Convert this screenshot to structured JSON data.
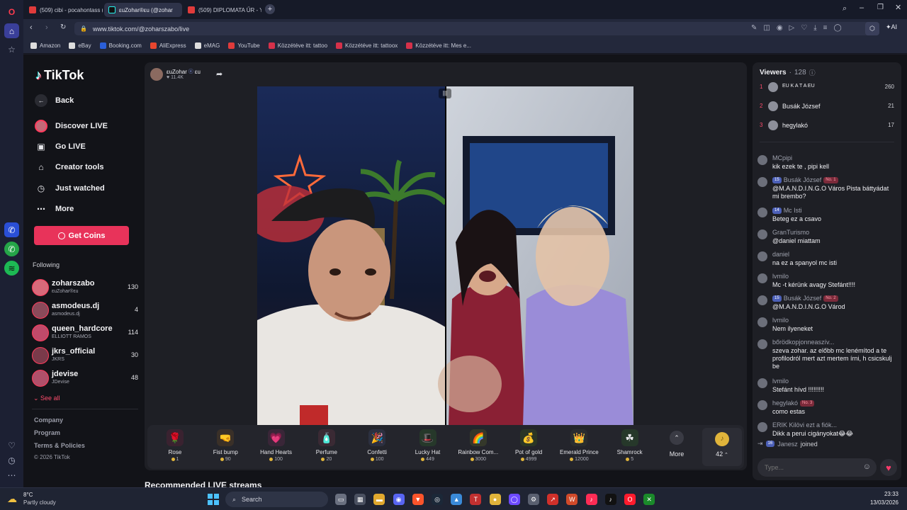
{
  "browser": {
    "tabs": [
      {
        "label": "(509) cibi - pocahontass (",
        "color": "#e03b3b"
      },
      {
        "label": "εuZohar®εu (@zohar",
        "color": "#25f4ee"
      },
      {
        "label": "(509) DIPLOMATA ŰR - Yo",
        "color": "#e03b3b"
      }
    ],
    "new_tab": "+",
    "url": "www.tiktok.com/@zoharszabo/live",
    "ai_label": "AI",
    "bookmarks": [
      {
        "label": "Amazon",
        "color": "#dddddd"
      },
      {
        "label": "eBay",
        "color": "#dddddd"
      },
      {
        "label": "Booking.com",
        "color": "#2b5fd9"
      },
      {
        "label": "AliExpress",
        "color": "#e8462f"
      },
      {
        "label": "eMAG",
        "color": "#dddddd"
      },
      {
        "label": "YouTube",
        "color": "#e03b3b"
      },
      {
        "label": "Közzétéve itt: tattoo",
        "color": "#d6314a"
      },
      {
        "label": "Közzétéve itt: tattoox",
        "color": "#d6314a"
      },
      {
        "label": "Közzétéve itt: Mes e...",
        "color": "#d6314a"
      }
    ]
  },
  "sidebar": {
    "logo": "TikTok",
    "nav": [
      {
        "label": "Back",
        "icon": "arrow-left-icon"
      },
      {
        "label": "Discover LIVE",
        "icon": "avatar-icon"
      },
      {
        "label": "Go LIVE",
        "icon": "camera-icon"
      },
      {
        "label": "Creator tools",
        "icon": "home-icon"
      },
      {
        "label": "Just watched",
        "icon": "history-icon"
      },
      {
        "label": "More",
        "icon": "more-icon"
      }
    ],
    "get_coins": "Get Coins",
    "following_title": "Following",
    "following": [
      {
        "name": "zoharszabo",
        "sub": "εuZohar®εu",
        "count": "130",
        "color": "#d86a7a"
      },
      {
        "name": "asmodeus.dj",
        "sub": "asmodeus.dj",
        "count": "4",
        "color": "#8a4a5a"
      },
      {
        "name": "queen_hardcore",
        "sub": "ELLIOTT RAMOS",
        "count": "114",
        "color": "#c04a6a"
      },
      {
        "name": "jkrs_official",
        "sub": "JKRS",
        "count": "30",
        "color": "#7a3a4a"
      },
      {
        "name": "jdevise",
        "sub": "JDevise",
        "count": "48",
        "color": "#b0506a"
      }
    ],
    "see_all": "See all",
    "footer": [
      "Company",
      "Program",
      "Terms & Policies"
    ],
    "copyright": "© 2026 TikTok"
  },
  "stream": {
    "host_name": "εuZohar",
    "host_suffix": "εu",
    "likes": "11.4K",
    "recommended_title": "Recommended LIVE streams",
    "gifts": [
      {
        "name": "Rose",
        "price": "1",
        "emoji": "🌹",
        "bg": "#3a2230"
      },
      {
        "name": "Fist bump",
        "price": "90",
        "emoji": "🤜",
        "bg": "#3a3028"
      },
      {
        "name": "Hand Hearts",
        "price": "100",
        "emoji": "💗",
        "bg": "#3a2638"
      },
      {
        "name": "Perfume",
        "price": "20",
        "emoji": "🧴",
        "bg": "#3a2a34"
      },
      {
        "name": "Confetti",
        "price": "100",
        "emoji": "🎉",
        "bg": "#2c3040"
      },
      {
        "name": "Lucky Hat",
        "price": "449",
        "emoji": "🎩",
        "bg": "#26382a"
      },
      {
        "name": "Rainbow Com...",
        "price": "3000",
        "emoji": "🌈",
        "bg": "#34382a"
      },
      {
        "name": "Pot of gold",
        "price": "4999",
        "emoji": "💰",
        "bg": "#2a3626"
      },
      {
        "name": "Emerald Prince",
        "price": "12000",
        "emoji": "👑",
        "bg": "#2a2e30"
      },
      {
        "name": "Shamrock",
        "price": "5",
        "emoji": "☘",
        "bg": "#26382a"
      }
    ],
    "more_label": "More",
    "coins_count": "42"
  },
  "chat": {
    "viewers_label": "Viewers",
    "viewers_count": "128",
    "top_viewers": [
      {
        "rank": "1",
        "name": "ΕU Κ Α Τ Α ΕU",
        "score": "260"
      },
      {
        "rank": "2",
        "name": "Busák József",
        "score": "21"
      },
      {
        "rank": "3",
        "name": "hegylakó",
        "score": "17"
      }
    ],
    "messages": [
      {
        "user": "MCpipi",
        "text": "kik ezek te , pipi kell",
        "level": "",
        "rank": ""
      },
      {
        "user": "Busák József",
        "text": "@M.A.N.D.I.N.G.O Város Pista báttyádat mi brembo?",
        "level": "15",
        "rank": "No. 1"
      },
      {
        "user": "Mc Isti",
        "text": "Beteg ez a csavo",
        "level": "14",
        "rank": ""
      },
      {
        "user": "GranTurismo",
        "text": "@daniel miattam",
        "level": "",
        "rank": ""
      },
      {
        "user": "daniel",
        "text": "na ez a spanyol mc isti",
        "level": "",
        "rank": ""
      },
      {
        "user": "lvmilo",
        "text": "Mc -t kérünk avagy Stefánt!!!!",
        "level": "",
        "rank": ""
      },
      {
        "user": "Busák József",
        "text": "@M.A.N.D.I.N.G.O Várod",
        "level": "15",
        "rank": "No. 2"
      },
      {
        "user": "lvmilo",
        "text": "Nem ilyeneket",
        "level": "",
        "rank": ""
      },
      {
        "user": "bőrödkopjonneaszív...",
        "text": "szeva zohar. az előbb mc lenémítod a te profilodról mert azt mertem írni, h csicskulj be",
        "level": "",
        "rank": ""
      },
      {
        "user": "lvmilo",
        "text": "Stefánt hívd !!!!!!!!!",
        "level": "",
        "rank": ""
      },
      {
        "user": "hegylakó",
        "text": "como estas",
        "level": "",
        "rank": "No. 3"
      },
      {
        "user": "ERIK Kilövi ezt a fiók...",
        "text": "Dikk a perui cigányokat😂😂",
        "level": "",
        "rank": ""
      }
    ],
    "joined": {
      "level": "16",
      "user": "Janesz",
      "text": "joined"
    },
    "input_placeholder": "Type..."
  },
  "taskbar": {
    "temp": "8°C",
    "weather": "Partly cloudy",
    "search": "Search",
    "time": "23:33",
    "date": "13/03/2026"
  }
}
